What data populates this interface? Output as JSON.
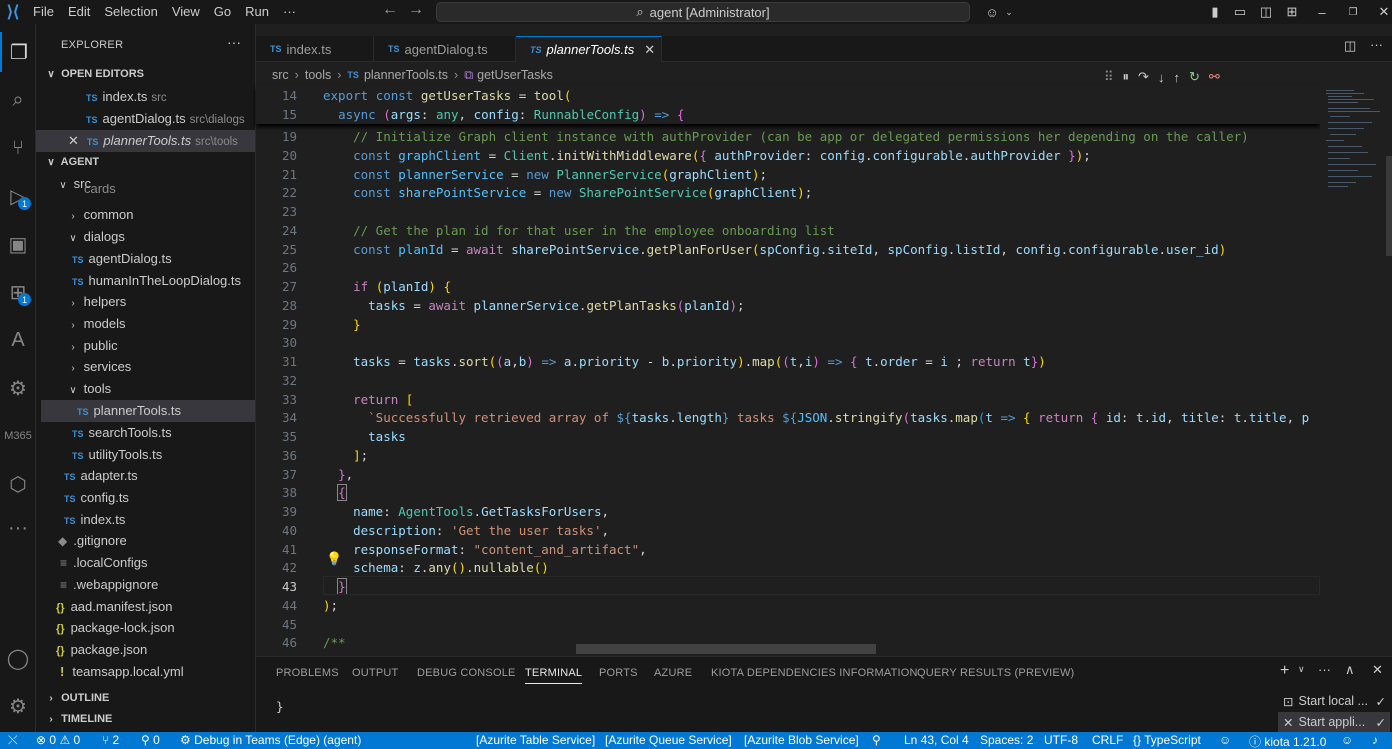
{
  "titlebar": {
    "menu": [
      "File",
      "Edit",
      "Selection",
      "View",
      "Go",
      "Run",
      "···"
    ],
    "search_text": "agent [Administrator]"
  },
  "activity_badges": {
    "debug": "1",
    "extensions": "1"
  },
  "sidebar": {
    "title": "EXPLORER",
    "open_editors_label": "OPEN EDITORS",
    "open_editors": [
      {
        "name": "index.ts",
        "path": "src"
      },
      {
        "name": "agentDialog.ts",
        "path": "src\\dialogs"
      },
      {
        "name": "plannerTools.ts",
        "path": "src\\tools"
      }
    ],
    "root_label": "AGENT",
    "tree": {
      "src": "src",
      "cards": "cards",
      "common": "common",
      "dialogs": "dialogs",
      "agentDialog": "agentDialog.ts",
      "humanInTheLoopDialog": "humanInTheLoopDialog.ts",
      "helpers": "helpers",
      "models": "models",
      "public": "public",
      "services": "services",
      "tools": "tools",
      "plannerTools": "plannerTools.ts",
      "searchTools": "searchTools.ts",
      "utilityTools": "utilityTools.ts",
      "adapter": "adapter.ts",
      "config": "config.ts",
      "index": "index.ts",
      "gitignore": ".gitignore",
      "localConfigs": ".localConfigs",
      "webappignore": ".webappignore",
      "aad": "aad.manifest.json",
      "packageLock": "package-lock.json",
      "package": "package.json",
      "teamsapp": "teamsapp.local.yml"
    },
    "outline_label": "OUTLINE",
    "timeline_label": "TIMELINE"
  },
  "tabs": [
    "index.ts",
    "agentDialog.ts",
    "plannerTools.ts"
  ],
  "breadcrumb": [
    "src",
    "tools",
    "plannerTools.ts",
    "getUserTasks"
  ],
  "editor": {
    "line_numbers": [
      "14",
      "15",
      "19",
      "20",
      "21",
      "22",
      "23",
      "24",
      "25",
      "26",
      "27",
      "28",
      "29",
      "30",
      "31",
      "32",
      "33",
      "34",
      "35",
      "36",
      "37",
      "38",
      "39",
      "40",
      "41",
      "42",
      "43",
      "44",
      "45",
      "46"
    ]
  },
  "panel": {
    "tabs": [
      "PROBLEMS",
      "OUTPUT",
      "DEBUG CONSOLE",
      "TERMINAL",
      "PORTS",
      "AZURE",
      "KIOTA DEPENDENCIES INFORMATION",
      "QUERY RESULTS (PREVIEW)"
    ],
    "terminal_text": "}",
    "terminals": [
      "Start local ...",
      "Start appli..."
    ]
  },
  "statusbar": {
    "errors": "0",
    "warnings": "0",
    "branch_count": "2",
    "ports": "0",
    "debug": "Debug in Teams (Edge) (agent)",
    "azurite_table": "[Azurite Table Service]",
    "azurite_queue": "[Azurite Queue Service]",
    "azurite_blob": "[Azurite Blob Service]",
    "position": "Ln 43, Col 4",
    "spaces": "Spaces: 2",
    "encoding": "UTF-8",
    "eol": "CRLF",
    "language": "TypeScript",
    "kiota": "kiota 1.21.0"
  },
  "colors": {
    "accent": "#0078d4",
    "background": "#1f1f1f",
    "sidebar": "#181818"
  }
}
